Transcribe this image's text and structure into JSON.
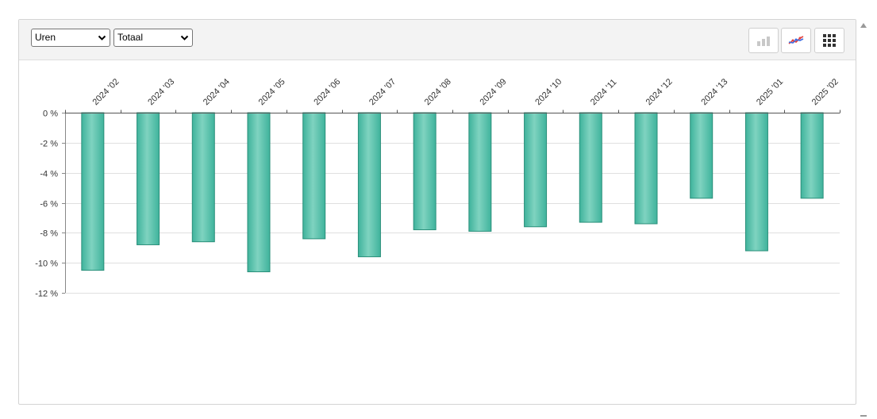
{
  "controls": {
    "measure_select": "Uren",
    "scope_select": "Totaal"
  },
  "toolbar_icons": [
    "bar-chart-icon",
    "line-chart-icon",
    "grid-icon"
  ],
  "colors": {
    "bar_light": "#7fd3c0",
    "bar_dark": "#3fb39c",
    "bar_stroke": "#2a8f7a",
    "grid": "#e0e0e0",
    "toolbar_bg": "#f3f3f3"
  },
  "chart_data": {
    "type": "bar",
    "categories": [
      "2024 '02",
      "2024 '03",
      "2024 '04",
      "2024 '05",
      "2024 '06",
      "2024 '07",
      "2024 '08",
      "2024 '09",
      "2024 '10",
      "2024 '11",
      "2024 '12",
      "2024 '13",
      "2025 '01",
      "2025 '02"
    ],
    "values": [
      -10.5,
      -8.8,
      -8.6,
      -10.6,
      -8.4,
      -9.6,
      -7.8,
      -7.9,
      -7.6,
      -7.3,
      -7.4,
      -5.7,
      -9.2,
      -5.7
    ],
    "ylim": [
      -12,
      0
    ],
    "yticks": [
      0,
      -2,
      -4,
      -6,
      -8,
      -10,
      -12
    ],
    "ytick_labels": [
      "0 %",
      "-2 %",
      "-4 %",
      "-6 %",
      "-8 %",
      "-10 %",
      "-12 %"
    ],
    "x_axis_position": "top",
    "grid": true
  }
}
